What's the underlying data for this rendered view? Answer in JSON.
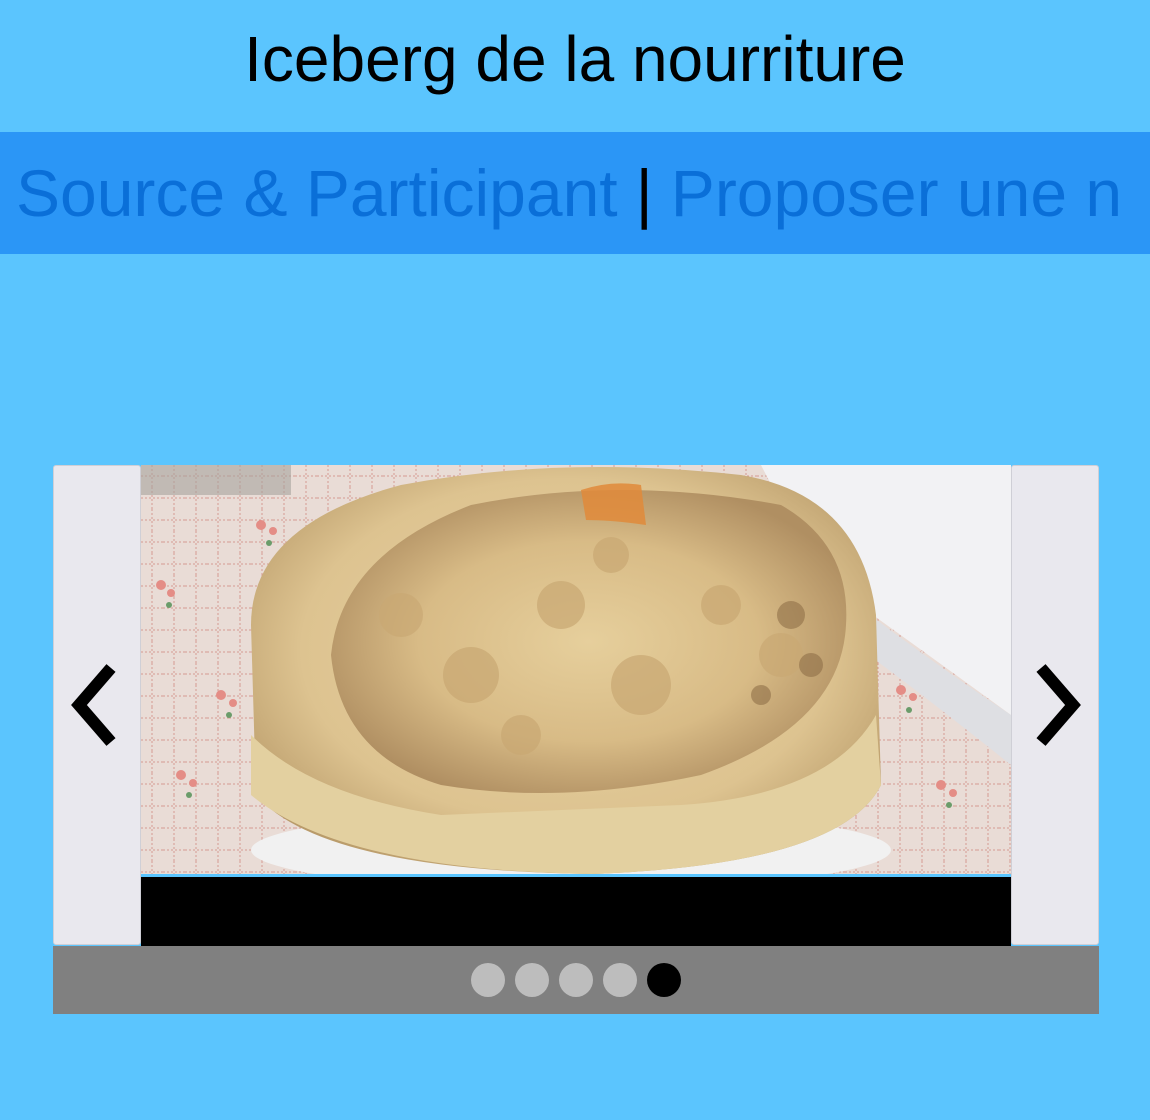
{
  "header": {
    "title": "Iceberg de la nourriture"
  },
  "nav": {
    "links": [
      {
        "label": "Source & Participant"
      },
      {
        "label": "Proposer une n"
      }
    ],
    "separator": "|"
  },
  "carousel": {
    "prev_icon": "chevron-left-icon",
    "next_icon": "chevron-right-icon",
    "image_alt": "Casu marzu cheese wheel on a tablecloth",
    "caption": "",
    "slide_count": 5,
    "active_index": 4
  },
  "colors": {
    "page_background": "#5bc5fe",
    "nav_background": "#2b96f6",
    "nav_link": "#0a6fd8",
    "arrow_background": "#e9e8ee",
    "dots_bar": "#808080",
    "dot_inactive": "#bdbdbd",
    "dot_active": "#000000"
  }
}
